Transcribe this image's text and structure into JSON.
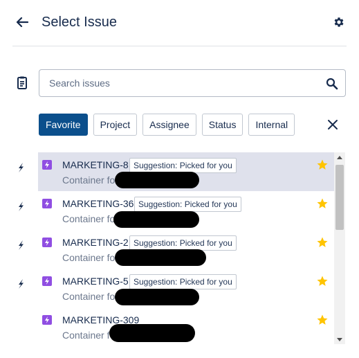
{
  "header": {
    "title": "Select Issue",
    "back_icon": "arrow-left-icon",
    "settings_icon": "gear-icon"
  },
  "search": {
    "placeholder": "Search issues",
    "value": ""
  },
  "filters": [
    {
      "label": "Favorite",
      "active": true
    },
    {
      "label": "Project",
      "active": false
    },
    {
      "label": "Assignee",
      "active": false
    },
    {
      "label": "Status",
      "active": false
    },
    {
      "label": "Internal",
      "active": false
    }
  ],
  "issues": [
    {
      "key": "MARKETING-8",
      "badge": "Suggestion: Picked for you",
      "summary": "Container fo",
      "selected": true,
      "starred": true
    },
    {
      "key": "MARKETING-36",
      "badge": "Suggestion: Picked for you",
      "summary": "Container fo",
      "selected": false,
      "starred": true
    },
    {
      "key": "MARKETING-2",
      "badge": "Suggestion: Picked for you",
      "summary": "Container fo",
      "selected": false,
      "starred": true
    },
    {
      "key": "MARKETING-5",
      "badge": "Suggestion: Picked for you",
      "summary": "Container fo",
      "selected": false,
      "starred": true
    },
    {
      "key": "MARKETING-309",
      "badge": "",
      "summary": "Container f",
      "selected": false,
      "starred": true
    }
  ],
  "colors": {
    "active_chip": "#0b4f8c",
    "issue_type": "#904ee2",
    "star": "#ffc400",
    "selected_row": "#dfe1ec"
  }
}
